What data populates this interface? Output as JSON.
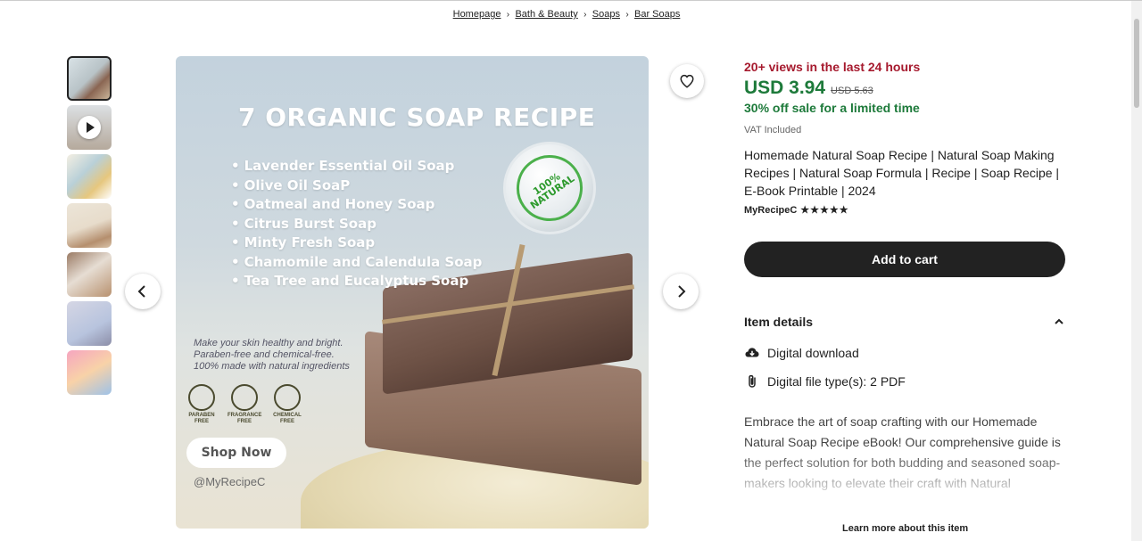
{
  "breadcrumb": {
    "items": [
      "Homepage",
      "Bath & Beauty",
      "Soaps",
      "Bar Soaps"
    ]
  },
  "thumbnails": {
    "count": 7,
    "active_index": 0
  },
  "main_image": {
    "title": "7 ORGANIC SOAP RECIPE",
    "list": [
      "Lavender Essential Oil Soap",
      "Olive Oil SoaP",
      "Oatmeal and Honey Soap",
      "Citrus Burst Soap",
      "Minty Fresh Soap",
      "Chamomile and Calendula Soap",
      "Tea Tree and Eucalyptus Soap"
    ],
    "seal_text": "100% NATURAL",
    "tagline": [
      "Make your skin healthy and bright.",
      "Paraben-free and chemical-free.",
      "100% made with natural ingredients"
    ],
    "badges": [
      "PARABEN FREE",
      "FRAGRANCE FREE",
      "CHEMICAL FREE"
    ],
    "shop_now": "Shop Now",
    "handle": "@MyRecipeC"
  },
  "product": {
    "views": "20+ views in the last 24 hours",
    "price": "USD 3.94",
    "old_price": "USD 5.63",
    "sale": "30% off sale for a limited time",
    "vat": "VAT Included",
    "title": "Homemade Natural Soap Recipe | Natural Soap Making Recipes | Natural Soap Formula | Recipe | Soap Recipe | E-Book Printable | 2024",
    "shop_name": "MyRecipeC",
    "stars": "★★★★★",
    "rating": 5,
    "add_to_cart": "Add to cart",
    "details_header": "Item details",
    "download_label": "Digital download",
    "file_type_label": "Digital file type(s): 2 PDF",
    "description": "Embrace the art of soap crafting with our Homemade Natural Soap Recipe eBook! Our comprehensive guide is the perfect solution for both budding and seasoned soap-makers looking to elevate their craft with Natural",
    "learn_more": "Learn more about this item"
  },
  "colors": {
    "views_red": "#a61a2e",
    "price_green": "#1d7a3a",
    "button_dark": "#222222"
  },
  "icons": [
    "heart-icon",
    "chevron-left-icon",
    "chevron-right-icon",
    "chevron-up-icon",
    "cloud-download-icon",
    "paperclip-icon",
    "play-icon"
  ]
}
